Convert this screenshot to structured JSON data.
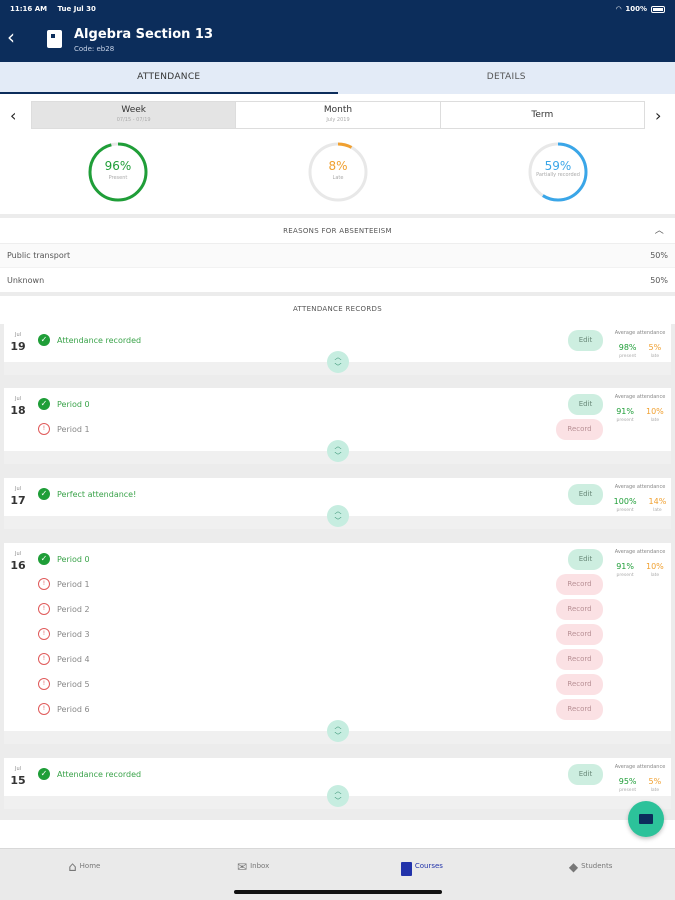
{
  "status_bar": {
    "time": "11:16 AM",
    "date": "Tue Jul 30",
    "battery": "100%"
  },
  "header": {
    "title": "Algebra Section 13",
    "code": "Code: eb28"
  },
  "tabs": [
    {
      "label": "ATTENDANCE"
    },
    {
      "label": "DETAILS"
    }
  ],
  "period": {
    "items": [
      {
        "label": "Week",
        "sub": "07/15 - 07/19"
      },
      {
        "label": "Month",
        "sub": "July 2019"
      },
      {
        "label": "Term",
        "sub": ""
      }
    ],
    "selected": "Week"
  },
  "gauges": [
    {
      "value": "96%",
      "label": "Present",
      "fraction": 0.96,
      "color": "#1f9e38",
      "text_color": "#1f9e38"
    },
    {
      "value": "8%",
      "label": "Late",
      "fraction": 0.08,
      "color": "#f0a030",
      "text_color": "#f0a030"
    },
    {
      "value": "59%",
      "label": "Partially recorded",
      "fraction": 0.59,
      "color": "#3aa6e8",
      "text_color": "#3aa6e8"
    }
  ],
  "reasons": {
    "title": "REASONS FOR ABSENTEEISM",
    "rows": [
      {
        "label": "Public transport",
        "value": "50%"
      },
      {
        "label": "Unknown",
        "value": "50%"
      }
    ]
  },
  "records": {
    "title": "ATTENDANCE RECORDS",
    "days": [
      {
        "month": "Jul",
        "day": "19",
        "avg_title": "Average attendance",
        "present": "98%",
        "present_label": "present",
        "late": "5%",
        "late_label": "late",
        "periods": [
          {
            "label": "Attendance recorded",
            "status": "ok",
            "action": "Edit"
          }
        ]
      },
      {
        "month": "Jul",
        "day": "18",
        "avg_title": "Average attendance",
        "present": "91%",
        "present_label": "present",
        "late": "10%",
        "late_label": "late",
        "periods": [
          {
            "label": "Period 0",
            "status": "ok",
            "action": "Edit"
          },
          {
            "label": "Period 1",
            "status": "missing",
            "action": "Record"
          }
        ]
      },
      {
        "month": "Jul",
        "day": "17",
        "avg_title": "Average attendance",
        "present": "100%",
        "present_label": "present",
        "late": "14%",
        "late_label": "late",
        "periods": [
          {
            "label": "Perfect attendance!",
            "status": "ok",
            "action": "Edit"
          }
        ]
      },
      {
        "month": "Jul",
        "day": "16",
        "avg_title": "Average attendance",
        "present": "91%",
        "present_label": "present",
        "late": "10%",
        "late_label": "late",
        "periods": [
          {
            "label": "Period 0",
            "status": "ok",
            "action": "Edit"
          },
          {
            "label": "Period 1",
            "status": "missing",
            "action": "Record"
          },
          {
            "label": "Period 2",
            "status": "missing",
            "action": "Record"
          },
          {
            "label": "Period 3",
            "status": "missing",
            "action": "Record"
          },
          {
            "label": "Period 4",
            "status": "missing",
            "action": "Record"
          },
          {
            "label": "Period 5",
            "status": "missing",
            "action": "Record"
          },
          {
            "label": "Period 6",
            "status": "missing",
            "action": "Record"
          }
        ]
      },
      {
        "month": "Jul",
        "day": "15",
        "avg_title": "Average attendance",
        "present": "95%",
        "present_label": "present",
        "late": "5%",
        "late_label": "late",
        "periods": [
          {
            "label": "Attendance recorded",
            "status": "ok",
            "action": "Edit"
          }
        ]
      }
    ]
  },
  "bottom_nav": [
    {
      "label": "Home",
      "icon": "home-icon"
    },
    {
      "label": "Inbox",
      "icon": "inbox-icon"
    },
    {
      "label": "Courses",
      "icon": "courses-icon",
      "active": true
    },
    {
      "label": "Students",
      "icon": "students-icon"
    }
  ]
}
